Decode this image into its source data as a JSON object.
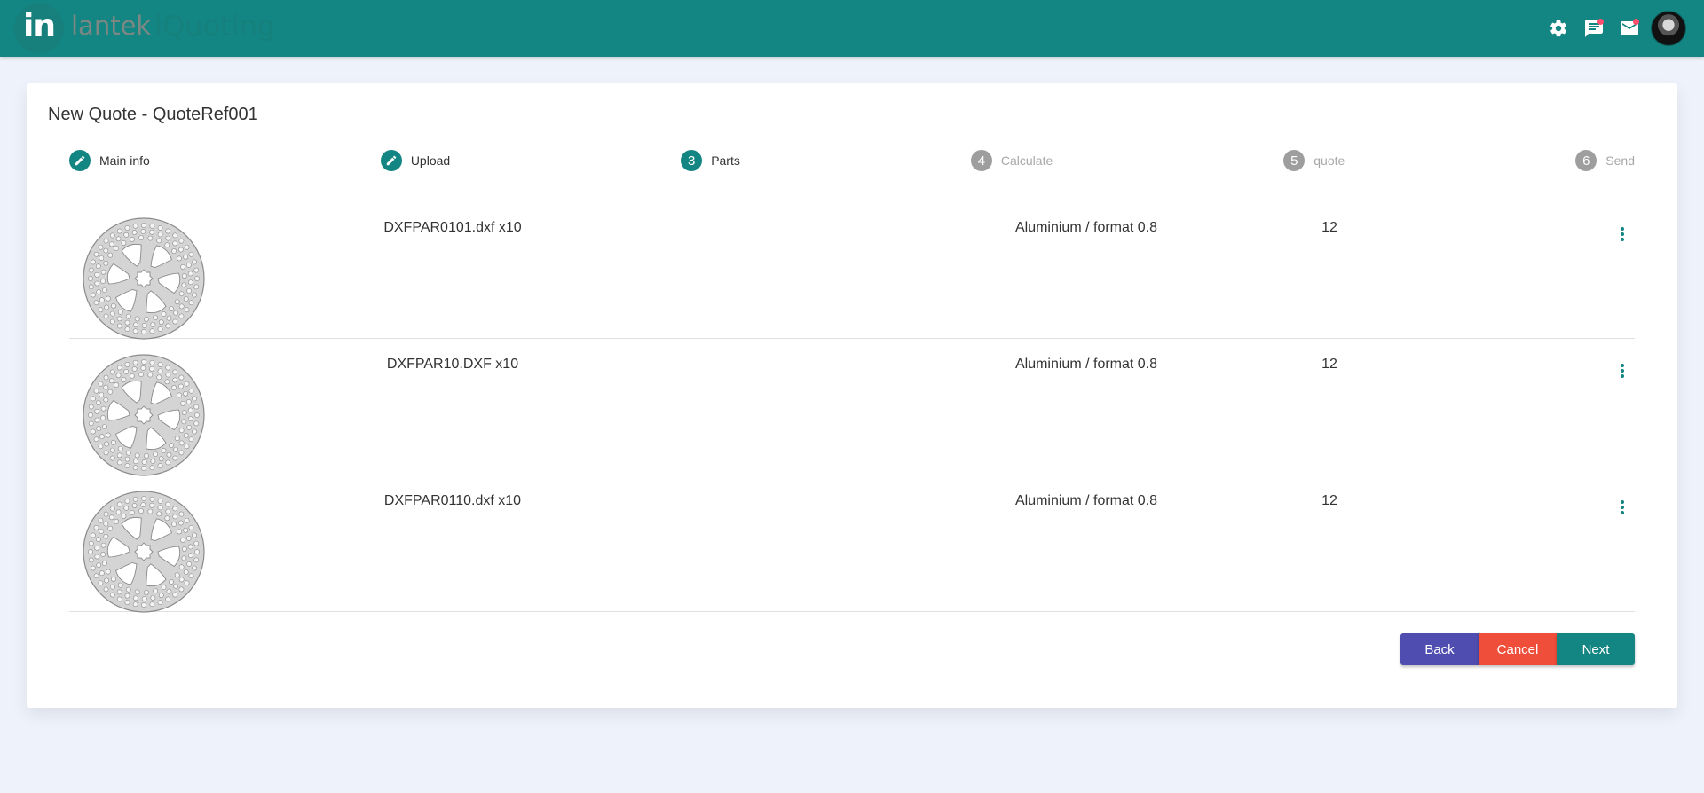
{
  "header": {
    "logo_mark": "in",
    "logo_brand": "lantek",
    "logo_product": "iQuoting",
    "icons": [
      {
        "name": "gear-icon",
        "notification": false
      },
      {
        "name": "chat-icon",
        "notification": true
      },
      {
        "name": "mail-icon",
        "notification": true
      }
    ],
    "avatar": "user-avatar"
  },
  "page": {
    "title": "New Quote - QuoteRef001"
  },
  "stepper": {
    "steps": [
      {
        "index": "1",
        "label": "Main info",
        "state": "done",
        "icon": "pencil-icon"
      },
      {
        "index": "2",
        "label": "Upload",
        "state": "done",
        "icon": "pencil-icon"
      },
      {
        "index": "3",
        "label": "Parts",
        "state": "active"
      },
      {
        "index": "4",
        "label": "Calculate",
        "state": "todo"
      },
      {
        "index": "5",
        "label": "quote",
        "state": "todo"
      },
      {
        "index": "6",
        "label": "Send",
        "state": "todo"
      }
    ]
  },
  "parts": [
    {
      "name": "DXFPAR0101.dxf x10",
      "material": "Aluminium / format 0.8",
      "quantity": "12",
      "thumbnail": "brake-disc-part"
    },
    {
      "name": "DXFPAR10.DXF x10",
      "material": "Aluminium / format 0.8",
      "quantity": "12",
      "thumbnail": "brake-disc-part"
    },
    {
      "name": "DXFPAR0110.dxf x10",
      "material": "Aluminium / format 0.8",
      "quantity": "12",
      "thumbnail": "brake-disc-part"
    }
  ],
  "actions": {
    "back_label": "Back",
    "cancel_label": "Cancel",
    "next_label": "Next"
  },
  "colors": {
    "primary": "#138582",
    "back": "#4f4db0",
    "cancel": "#ef4e3a",
    "notification": "#ff4f6e",
    "inactive_step": "#9e9e9e"
  }
}
